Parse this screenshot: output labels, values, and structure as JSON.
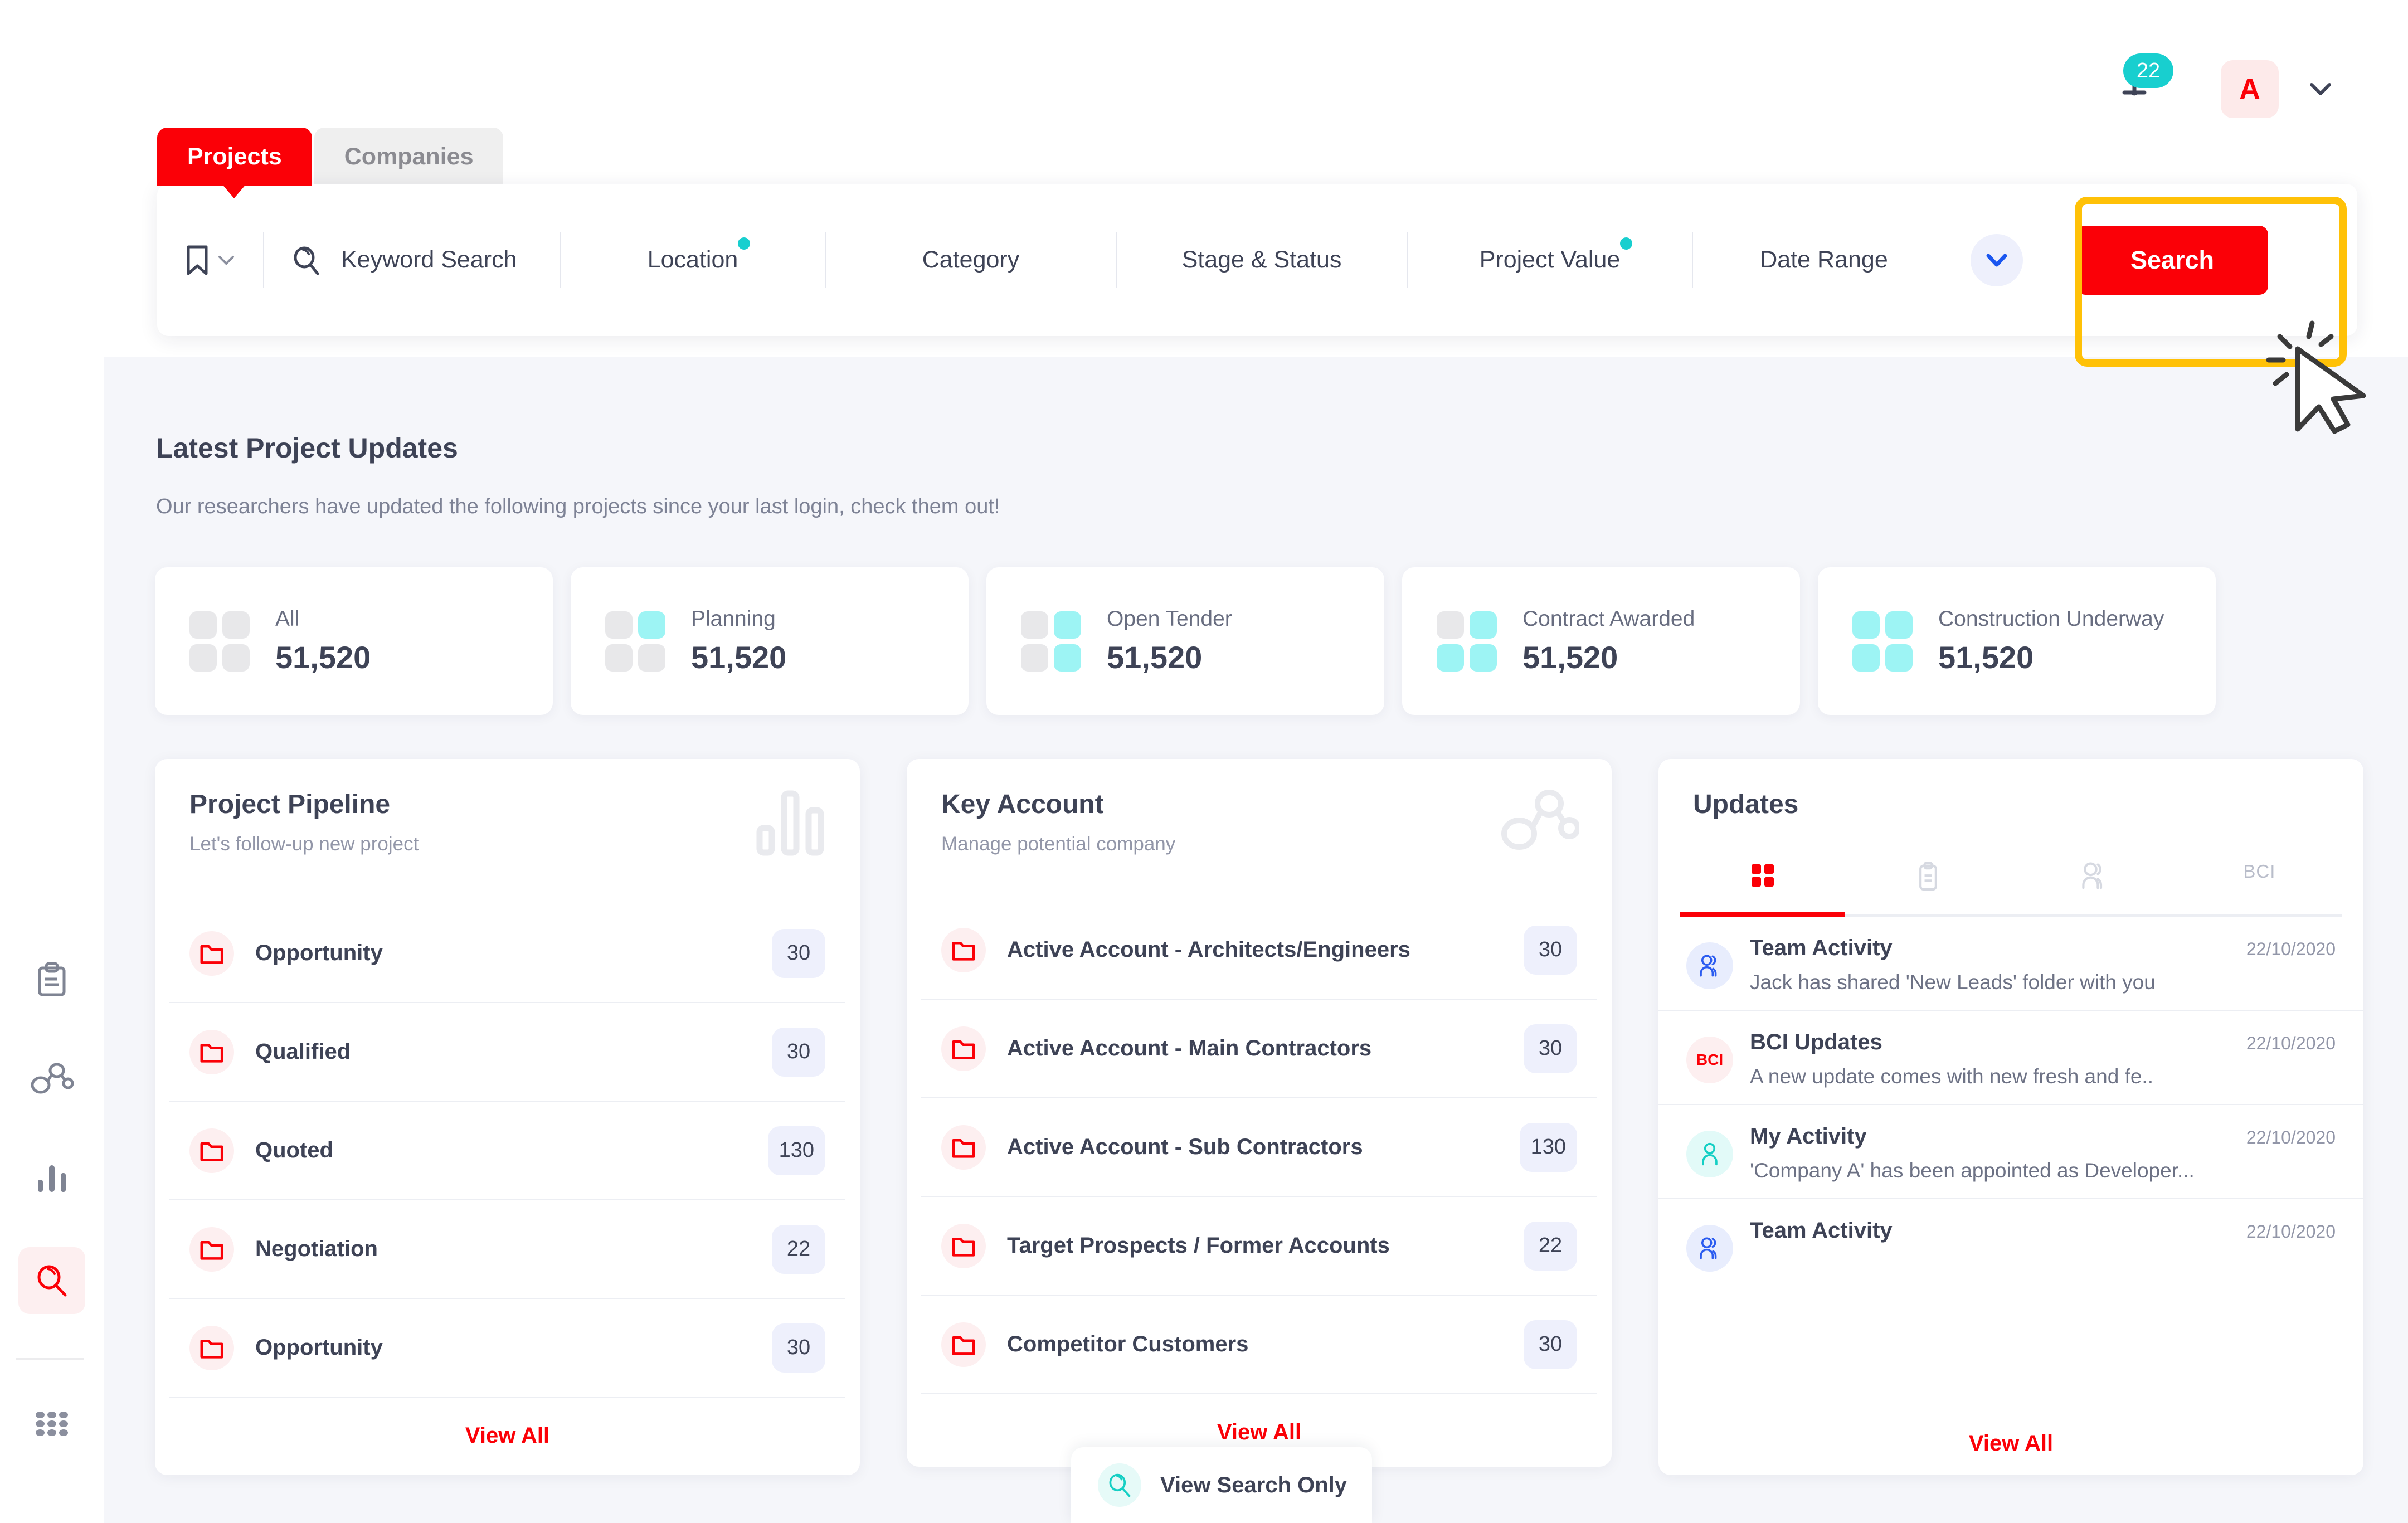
{
  "brand": {
    "accent": "#fb0007",
    "teal": "#18CFCF",
    "highlight": "#ffc107",
    "logo_icon": "bci-network-logo"
  },
  "header": {
    "notification_count": "22",
    "bell_icon": "bell-icon",
    "avatar_initial": "A",
    "avatar_caret_icon": "chevron-down-icon"
  },
  "tabs": [
    {
      "label": "Projects",
      "active": true
    },
    {
      "label": "Companies",
      "active": false
    }
  ],
  "search": {
    "bookmark_icon": "bookmark-icon",
    "bookmark_caret_icon": "chevron-down-icon",
    "search_icon": "search-icon",
    "keyword_placeholder": "Keyword Search",
    "filters": [
      {
        "label": "Location",
        "has_dot": true
      },
      {
        "label": "Category",
        "has_dot": false
      },
      {
        "label": "Stage & Status",
        "has_dot": false
      },
      {
        "label": "Project Value",
        "has_dot": true
      },
      {
        "label": "Date Range",
        "has_dot": false
      }
    ],
    "expand_caret_icon": "chevron-down-icon",
    "search_button_label": "Search"
  },
  "section": {
    "title": "Latest Project Updates",
    "subtitle": "Our researchers have updated the following projects since your last login, check them out!"
  },
  "stats": [
    {
      "label": "All",
      "value": "51,520",
      "filled": 0,
      "icon": "quad-grid-icon"
    },
    {
      "label": "Planning",
      "value": "51,520",
      "filled": 1,
      "icon": "quad-grid-icon"
    },
    {
      "label": "Open Tender",
      "value": "51,520",
      "filled": 2,
      "icon": "quad-grid-icon"
    },
    {
      "label": "Contract Awarded",
      "value": "51,520",
      "filled": 3,
      "icon": "quad-grid-icon"
    },
    {
      "label": "Construction Underway",
      "value": "51,520",
      "filled": 4,
      "icon": "quad-grid-icon"
    }
  ],
  "pipeline": {
    "title": "Project Pipeline",
    "subtitle": "Let's follow-up new project",
    "head_icon": "bar-chart-icon",
    "items": [
      {
        "label": "Opportunity",
        "count": "30",
        "icon": "folder-icon"
      },
      {
        "label": "Qualified",
        "count": "30",
        "icon": "folder-icon"
      },
      {
        "label": "Quoted",
        "count": "130",
        "icon": "folder-icon"
      },
      {
        "label": "Negotiation",
        "count": "22",
        "icon": "folder-icon"
      },
      {
        "label": "Opportunity",
        "count": "30",
        "icon": "folder-icon"
      }
    ],
    "view_all_label": "View All"
  },
  "key_account": {
    "title": "Key Account",
    "subtitle": "Manage potential company",
    "head_icon": "network-nodes-icon",
    "items": [
      {
        "label": "Active Account - Architects/Engineers",
        "count": "30",
        "icon": "folder-icon"
      },
      {
        "label": "Active Account - Main Contractors",
        "count": "30",
        "icon": "folder-icon"
      },
      {
        "label": "Active Account - Sub Contractors",
        "count": "130",
        "icon": "folder-icon"
      },
      {
        "label": "Target Prospects / Former Accounts",
        "count": "22",
        "icon": "folder-icon"
      },
      {
        "label": "Competitor Customers",
        "count": "30",
        "icon": "folder-icon"
      }
    ],
    "view_all_label": "View All"
  },
  "updates": {
    "title": "Updates",
    "tabs": [
      {
        "icon": "quad-grid-icon",
        "label": "",
        "active": true
      },
      {
        "icon": "clipboard-icon",
        "label": "",
        "active": false
      },
      {
        "icon": "people-icon",
        "label": "",
        "active": false
      },
      {
        "icon": "bci-text-icon",
        "label": "BCI",
        "active": false
      }
    ],
    "items": [
      {
        "title": "Team Activity",
        "date": "22/10/2020",
        "desc": "Jack has shared 'New Leads' folder with you",
        "avatar": "people-icon",
        "avatar_style": "blue"
      },
      {
        "title": "BCI Updates",
        "date": "22/10/2020",
        "desc": "A new update comes with new fresh and  fe..",
        "avatar": "bci-text-icon",
        "avatar_style": "red"
      },
      {
        "title": "My Activity",
        "date": "22/10/2020",
        "desc": "'Company A' has been appointed as Developer...",
        "avatar": "person-icon",
        "avatar_style": "teal"
      },
      {
        "title": "Team Activity",
        "date": "22/10/2020",
        "desc": "",
        "avatar": "people-icon",
        "avatar_style": "blue"
      }
    ],
    "view_all_label": "View All"
  },
  "sidebar": {
    "items": [
      {
        "icon": "clipboard-icon",
        "active": false
      },
      {
        "icon": "network-nodes-icon",
        "active": false
      },
      {
        "icon": "bar-chart-icon",
        "active": false
      },
      {
        "icon": "search-icon",
        "active": true
      },
      {
        "icon": "apps-grid-icon",
        "active": false
      }
    ]
  },
  "bottom_pill": {
    "label": "View Search Only",
    "icon": "search-icon"
  }
}
